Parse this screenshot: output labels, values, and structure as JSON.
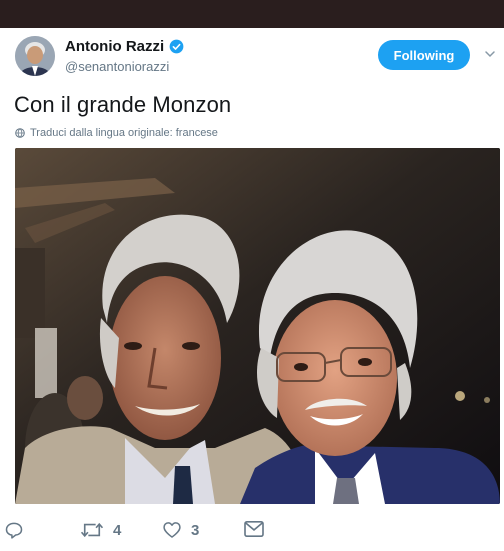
{
  "tweet": {
    "author": {
      "name": "Antonio Razzi",
      "handle": "@senantoniorazzi",
      "verified": true
    },
    "follow_button_label": "Following",
    "text": "Con il grande Monzon",
    "translate_label": "Traduci dalla lingua originale: francese",
    "photo_icon": "photo-of-two-men",
    "stats": {
      "retweets": "4",
      "likes": "3"
    }
  },
  "colors": {
    "accent": "#1da1f2",
    "text_primary": "#14171a",
    "text_secondary": "#657786",
    "top_bar": "#2a1e1e"
  },
  "icons": [
    "verified-badge-icon",
    "chevron-down-icon",
    "globe-icon",
    "reply-icon",
    "retweet-icon",
    "heart-icon",
    "message-icon"
  ]
}
